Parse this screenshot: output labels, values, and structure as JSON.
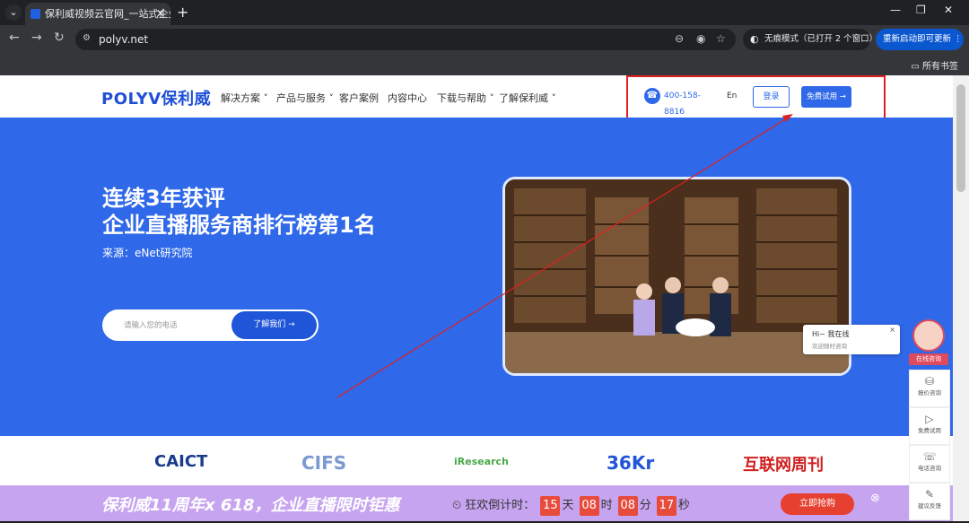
{
  "browser": {
    "tab_title": "保利威视频云官网_一站式企业",
    "url": "polyv.net",
    "incognito_label": "无痕模式（已打开 2 个窗口）",
    "restart_label": "重新启动即可更新",
    "bookmarks_label": "所有书签"
  },
  "header": {
    "logo": "POLYV保利威",
    "menu": [
      "解决方案",
      "产品与服务",
      "客户案例",
      "内容中心",
      "下载与帮助",
      "了解保利威"
    ],
    "phone": "400-158-8816",
    "lang": "En",
    "login": "登录",
    "trial": "免费试用 →"
  },
  "hero": {
    "title_line1": "连续3年获评",
    "title_line2": "企业直播服务商排行榜第1名",
    "source": "来源：eNet研究院",
    "phone_placeholder": "请输入您的电话",
    "cta": "了解我们 →"
  },
  "chat": {
    "greeting": "Hi~ 我在线",
    "sub": "欢迎随时咨询"
  },
  "partners": [
    "CAICT",
    "CIFS",
    "iResearch",
    "36Kr",
    "互联网周刊"
  ],
  "promo": {
    "title": "保利威11周年x 618，企业直播限时钜惠",
    "countdown_label": "狂欢倒计时：",
    "days": "15",
    "days_unit": "天",
    "hours": "08",
    "hours_unit": "时",
    "minutes": "08",
    "minutes_unit": "分",
    "seconds": "17",
    "seconds_unit": "秒",
    "grab": "立即抢购"
  },
  "side": {
    "online": "在线咨询",
    "price": "报价咨询",
    "trial": "免费试用",
    "call": "电话咨询",
    "feedback": "建议反馈"
  },
  "colors": {
    "brand": "#2f68e8",
    "annotation": "#e02020"
  }
}
